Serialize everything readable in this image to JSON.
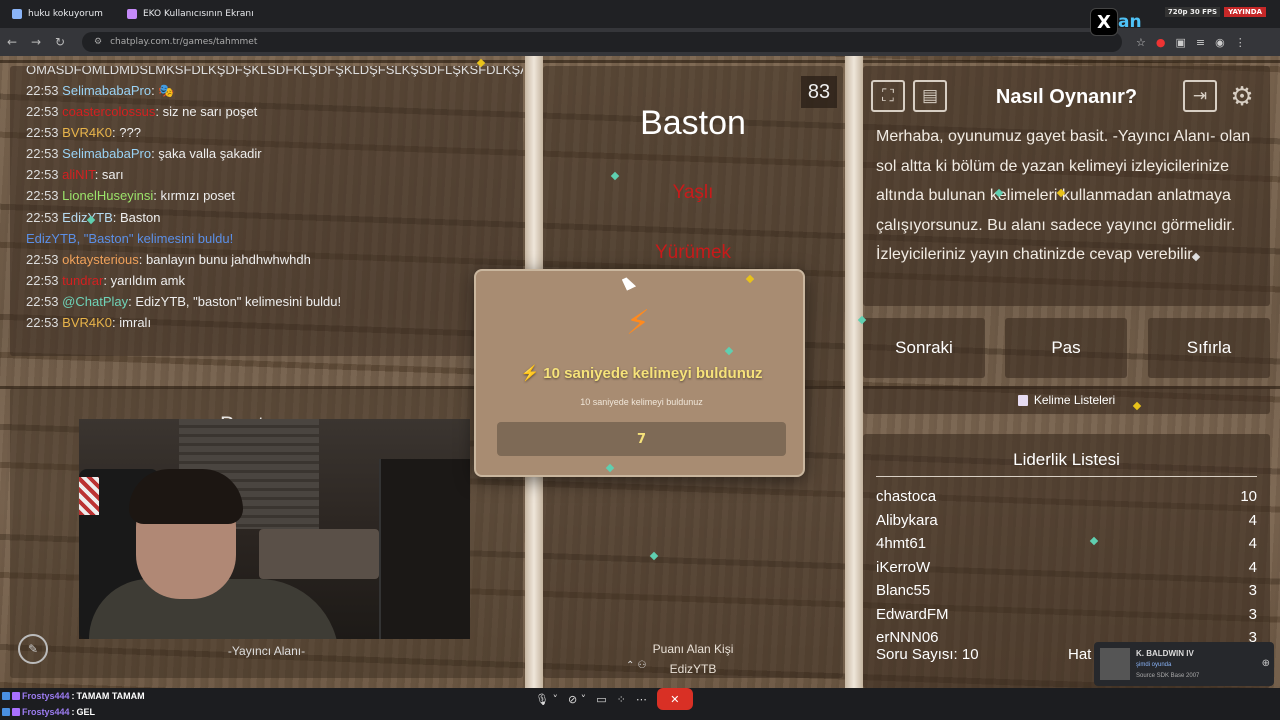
{
  "browser": {
    "tabs": [
      {
        "label": "huku kokuyorum"
      },
      {
        "label": "EKO Kullanıcısının Ekranı"
      }
    ],
    "url": "chatplay.com.tr/games/tahmmet",
    "stream": {
      "fps_label": "720p 30 FPS",
      "live_label": "YAYINDA",
      "logo_glyph": "X",
      "logo_suffix": "an"
    }
  },
  "chat": {
    "overflow_line": "OMASDFOMLDMDSLMKSFDLKŞDFŞKLSDFKLŞDFŞKLDŞFSLKŞSDFLŞKSFDLKŞA",
    "messages": [
      {
        "time": "22:53",
        "user": "SelimababaPro",
        "user_color": "#9ad3f5",
        "text": "🎭"
      },
      {
        "time": "22:53",
        "user": "coastercolossus",
        "user_color": "#d32020",
        "text": "siz ne sarı poşet"
      },
      {
        "time": "22:53",
        "user": "BVR4K0",
        "user_color": "#e8b44a",
        "text": "???"
      },
      {
        "time": "22:53",
        "user": "SelimababaPro",
        "user_color": "#9ad3f5",
        "text": "şaka valla şakadir"
      },
      {
        "time": "22:53",
        "user": "aliNIT",
        "user_color": "#d32020",
        "text": "sarı"
      },
      {
        "time": "22:53",
        "user": "LionelHuseyinsi",
        "user_color": "#9be36a",
        "text": "kırmızı poset"
      },
      {
        "time": "22:53",
        "user": "EdizYTB",
        "user_color": "#b6dbf2",
        "text": "Baston"
      },
      {
        "system": true,
        "text": "EdizYTB, \"Baston\" kelimesini buldu!"
      },
      {
        "time": "22:53",
        "user": "oktaysterious",
        "user_color": "#f0a15a",
        "text": "banlayın bunu jahdhwhwhdh"
      },
      {
        "time": "22:53",
        "user": "tundrar",
        "user_color": "#d32020",
        "text": "yarıldım amk"
      },
      {
        "time": "22:53",
        "user": "@ChatPlay",
        "user_color": "#6fd3b8",
        "text": "EdizYTB, \"baston\" kelimesini buldu!"
      },
      {
        "time": "22:53",
        "user": "BVR4K0",
        "user_color": "#e8b44a",
        "text": "imralı"
      }
    ]
  },
  "presenter": {
    "label": "-Yayıncı Alanı-",
    "word": "Baston"
  },
  "word_card": {
    "word": "Baston",
    "counter": "83",
    "forbidden": [
      "Yaşlı",
      "Yürümek"
    ],
    "scorer_label": "Puanı Alan Kişi",
    "scorer_name": "EdizYTB"
  },
  "popup": {
    "title": "⚡ 10 saniyede kelimeyi buldunuz",
    "subtitle": "10 saniyede kelimeyi buldunuz",
    "value": "7"
  },
  "howto": {
    "title": "Nasıl Oynanır?",
    "text": "Merhaba, oyunumuz gayet basit. -Yayıncı Alanı- olan sol altta ki bölüm de yazan kelimeyi izleyicilerinize altında bulunan kelimeleri kullanmadan anlatmaya çalışıyorsunuz. Bu alanı sadece yayıncı görmelidir. İzleyicileriniz yayın chatinizde cevap verebilir."
  },
  "controls": {
    "next": "Sonraki",
    "pass": "Pas",
    "reset": "Sıfırla",
    "word_lists": "Kelime Listeleri"
  },
  "leaderboard": {
    "title": "Liderlik Listesi",
    "rows": [
      {
        "name": "chastoca",
        "score": "10"
      },
      {
        "name": "Alibykara",
        "score": "4"
      },
      {
        "name": "4hmt61",
        "score": "4"
      },
      {
        "name": "iKerroW",
        "score": "4"
      },
      {
        "name": "Blanc55",
        "score": "3"
      },
      {
        "name": "EdwardFM",
        "score": "3"
      },
      {
        "name": "erNNN06",
        "score": "3"
      }
    ],
    "question_count": "Soru Sayısı: 10",
    "footer_right": "Hat"
  },
  "overlay_chat": [
    {
      "user": "Frostys444",
      "text": "TAMAM TAMAM"
    },
    {
      "user": "Frostys444",
      "text": "GEL"
    }
  ],
  "game_notification": {
    "title": "K. BALDWIN IV",
    "status": "şimdi oyunda",
    "game": "Source SDK Base 2007"
  },
  "colors": {
    "wood": "#6d5a47",
    "forbidden": "#c91a1a",
    "popup_bg": "#a88c72",
    "popup_title": "#f6e27a",
    "chat_system": "#5b8fe6"
  }
}
